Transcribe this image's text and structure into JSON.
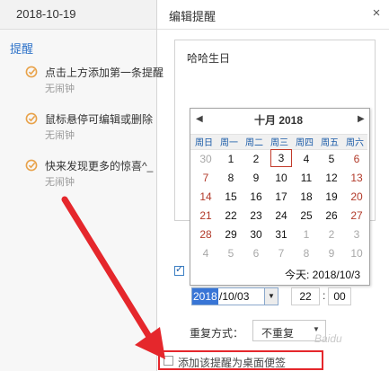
{
  "left_panel": {
    "date": "2018-10-19",
    "section": "提醒",
    "reminders": [
      {
        "title": "点击上方添加第一条提醒",
        "sub": "无闹钟"
      },
      {
        "title": "鼠标悬停可编辑或删除",
        "sub": "无闹钟"
      },
      {
        "title": "快来发现更多的惊喜^_",
        "sub": "无闹钟"
      }
    ]
  },
  "dialog": {
    "title": "编辑提醒",
    "close": "×",
    "note_text": "哈哈生日"
  },
  "calendar": {
    "prev": "◀",
    "next": "▶",
    "title": "十月  2018",
    "weekdays": [
      "周日",
      "周一",
      "周二",
      "周三",
      "周四",
      "周五",
      "周六"
    ],
    "weeks": [
      [
        "30",
        "1",
        "2",
        "3",
        "4",
        "5",
        "6"
      ],
      [
        "7",
        "8",
        "9",
        "10",
        "11",
        "12",
        "13"
      ],
      [
        "14",
        "15",
        "16",
        "17",
        "18",
        "19",
        "20"
      ],
      [
        "21",
        "22",
        "23",
        "24",
        "25",
        "26",
        "27"
      ],
      [
        "28",
        "29",
        "30",
        "31",
        "1",
        "2",
        "3"
      ],
      [
        "4",
        "5",
        "6",
        "7",
        "8",
        "9",
        "10"
      ]
    ],
    "selected": "3",
    "today": "今天: 2018/10/3"
  },
  "datetime": {
    "enabled_mark": "✓",
    "date_year": "2018",
    "date_rest": "/10/03",
    "drop_arrow": "▼",
    "hour": "22",
    "colon": ":",
    "minute": "00"
  },
  "repeat": {
    "label": "重复方式：",
    "value": "不重复",
    "arrow": "▼"
  },
  "desktop_note": {
    "label": "添加该提醒为桌面便签"
  },
  "watermark": "Baidu",
  "colors": {
    "accent": "#2f73c9",
    "selection": "#3875d6",
    "highlight_red": "#e5272c",
    "reminder_icon": "#e8a24a"
  }
}
